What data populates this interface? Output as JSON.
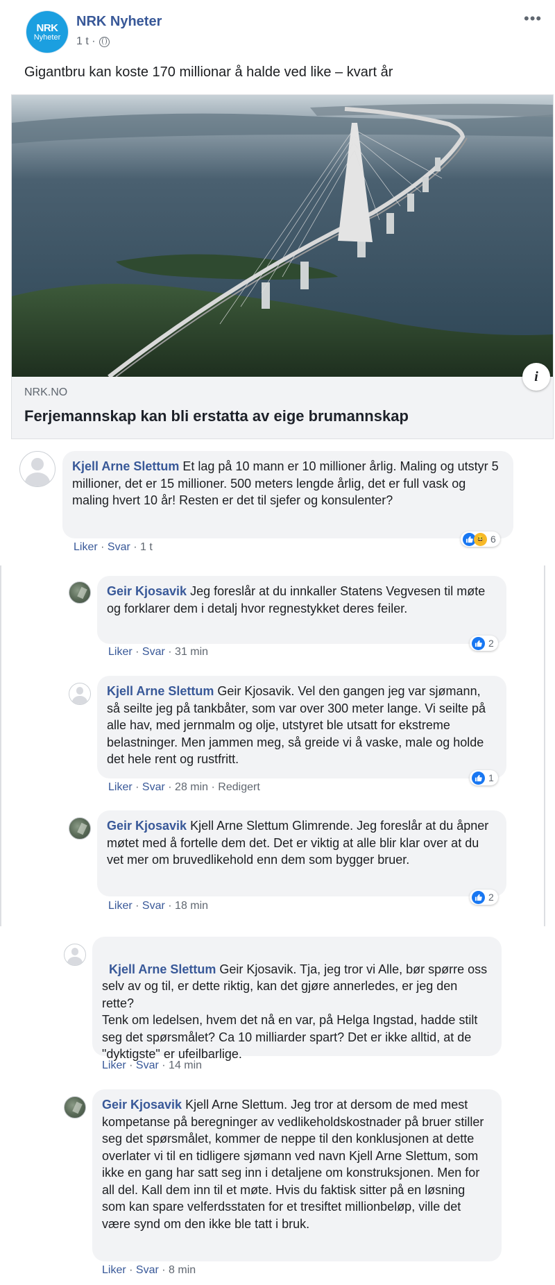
{
  "post": {
    "page_name": "NRK Nyheter",
    "avatar_line1": "NRK",
    "avatar_line2": "Nyheter",
    "time": "1 t ·",
    "more": "•••",
    "text": "Gigantbru kan koste 170 millionar å halde ved like – kvart år",
    "link": {
      "domain": "NRK.NO",
      "title": "Ferjemannskap kan bli erstatta av eige brumannskap",
      "info_icon": "i"
    }
  },
  "comments": [
    {
      "author": "Kjell Arne Slettum",
      "text": " Et lag på 10 mann er 10 millioner årlig. Maling og utstyr 5 millioner, det er 15 millioner. 500 meters lengde årlig, det er full vask og maling hvert 10 år! Resten er det til sjefer og konsulenter?",
      "like": "Liker",
      "reply": "Svar",
      "time": "· 1 t",
      "reactions": "6"
    },
    {
      "author": "Geir Kjosavik",
      "text": " Jeg foreslår at du innkaller Statens Vegvesen til møte og forklarer dem i detalj hvor regnestykket deres feiler.",
      "like": "Liker",
      "reply": "Svar",
      "time": "· 31 min",
      "reactions": "2"
    },
    {
      "author": "Kjell Arne Slettum",
      "text": " Geir Kjosavik. Vel den gangen jeg var sjømann, så seilte jeg på tankbåter, som var over 300 meter lange. Vi seilte på alle hav, med jernmalm og olje, utstyret ble utsatt for ekstreme belastninger. Men jammen meg, så greide vi å vaske, male og holde det hele rent og rustfritt.",
      "like": "Liker",
      "reply": "Svar",
      "time": "· 28 min · Redigert",
      "reactions": "1"
    },
    {
      "author": "Geir Kjosavik",
      "text": " Kjell Arne Slettum Glimrende. Jeg foreslår at du åpner møtet med å fortelle dem det. Det er viktig at alle blir klar over at du vet mer om bruvedlikehold enn dem som bygger bruer.",
      "like": "Liker",
      "reply": "Svar",
      "time": "· 18 min",
      "reactions": "2"
    },
    {
      "author": "Kjell Arne Slettum",
      "text": " Geir Kjosavik. Tja, jeg tror vi Alle, bør spørre oss selv av og til, er dette riktig, kan det gjøre annerledes, er jeg den rette?\nTenk om ledelsen, hvem det nå en var, på Helga Ingstad, hadde stilt seg det spørsmålet? Ca 10 milliarder spart? Det er ikke alltid, at de \"dyktigste\" er ufeilbarlige.",
      "like": "Liker",
      "reply": "Svar",
      "time": "· 14 min"
    },
    {
      "author": "Geir Kjosavik",
      "text": " Kjell Arne Slettum. Jeg tror at dersom de med mest kompetanse på beregninger av vedlikeholdskostnader på bruer stiller seg det spørsmålet, kommer de neppe til den konklusjonen at dette overlater vi til en tidligere sjømann ved navn Kjell Arne Slettum, som ikke en gang har satt seg inn i detaljene om konstruksjonen. Men for all del. Kall dem inn til et møte. Hvis du faktisk sitter på en løsning som kan spare velferdsstaten for et tresiftet millionbeløp, ville det være synd om den ikke ble tatt i bruk.",
      "like": "Liker",
      "reply": "Svar",
      "time": "· 8 min"
    }
  ],
  "colors": {
    "link_blue": "#385898",
    "bubble_gray": "#f2f3f5",
    "like_blue": "#1877f2",
    "nrk_blue": "#1b9fe0"
  }
}
